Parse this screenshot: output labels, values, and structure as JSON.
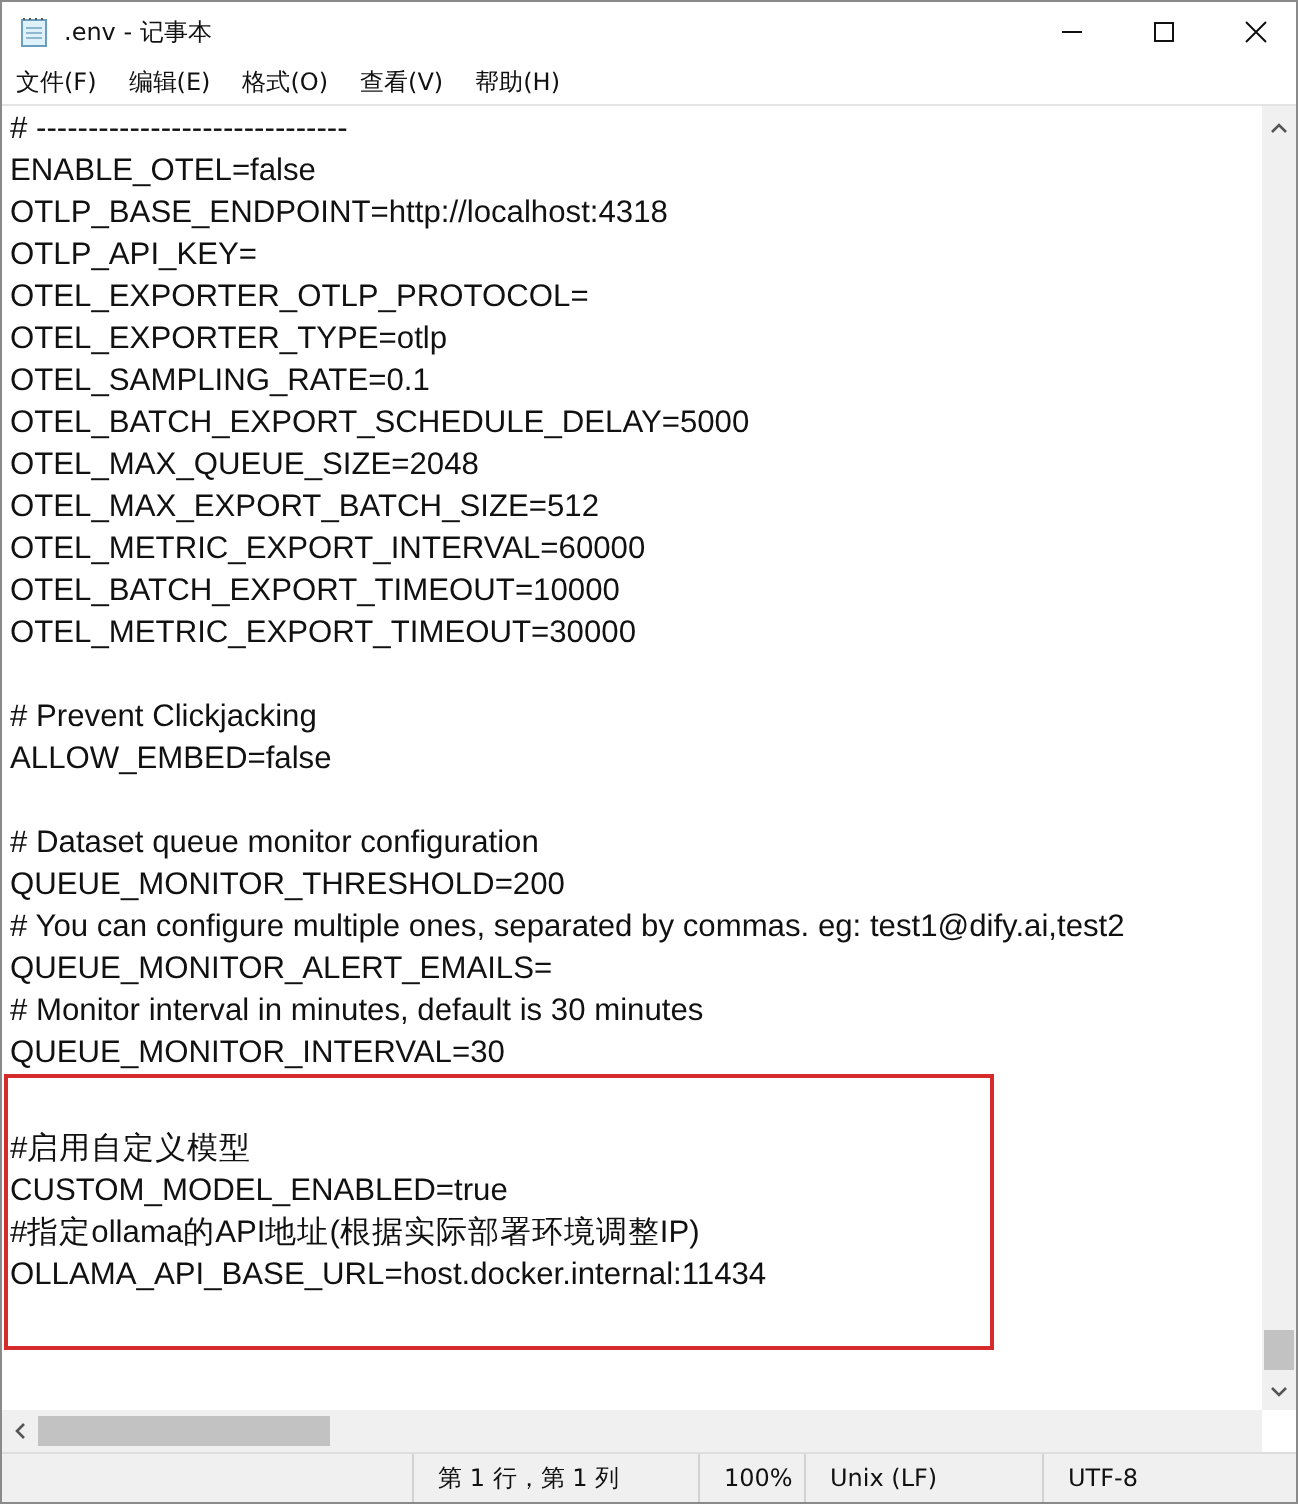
{
  "window": {
    "title": ".env - 记事本"
  },
  "menu": [
    "文件(F)",
    "编辑(E)",
    "格式(O)",
    "查看(V)",
    "帮助(H)"
  ],
  "editor": {
    "lines": [
      {
        "kind": "text",
        "text": "# ------------------------------"
      },
      {
        "kind": "text",
        "text": "ENABLE_OTEL=false"
      },
      {
        "kind": "text",
        "text": "OTLP_BASE_ENDPOINT=http://localhost:4318"
      },
      {
        "kind": "text",
        "text": "OTLP_API_KEY="
      },
      {
        "kind": "text",
        "text": "OTEL_EXPORTER_OTLP_PROTOCOL="
      },
      {
        "kind": "text",
        "text": "OTEL_EXPORTER_TYPE=otlp"
      },
      {
        "kind": "text",
        "text": "OTEL_SAMPLING_RATE=0.1"
      },
      {
        "kind": "text",
        "text": "OTEL_BATCH_EXPORT_SCHEDULE_DELAY=5000"
      },
      {
        "kind": "text",
        "text": "OTEL_MAX_QUEUE_SIZE=2048"
      },
      {
        "kind": "text",
        "text": "OTEL_MAX_EXPORT_BATCH_SIZE=512"
      },
      {
        "kind": "text",
        "text": "OTEL_METRIC_EXPORT_INTERVAL=60000"
      },
      {
        "kind": "text",
        "text": "OTEL_BATCH_EXPORT_TIMEOUT=10000"
      },
      {
        "kind": "text",
        "text": "OTEL_METRIC_EXPORT_TIMEOUT=30000"
      },
      {
        "kind": "blank"
      },
      {
        "kind": "text",
        "text": "# Prevent Clickjacking"
      },
      {
        "kind": "text",
        "text": "ALLOW_EMBED=false"
      },
      {
        "kind": "blank"
      },
      {
        "kind": "text",
        "text": "# Dataset queue monitor configuration"
      },
      {
        "kind": "text",
        "text": "QUEUE_MONITOR_THRESHOLD=200"
      },
      {
        "kind": "text",
        "text": "# You can configure multiple ones, separated by commas. eg: test1@dify.ai,test2"
      },
      {
        "kind": "text",
        "text": "QUEUE_MONITOR_ALERT_EMAILS="
      },
      {
        "kind": "text",
        "text": "# Monitor interval in minutes, default is 30 minutes"
      },
      {
        "kind": "text",
        "text": "QUEUE_MONITOR_INTERVAL=30"
      }
    ],
    "highlighted_block": {
      "lines": [
        {
          "kind": "blank"
        },
        {
          "kind": "text",
          "text": "#启用自定义模型"
        },
        {
          "kind": "text",
          "text": "CUSTOM_MODEL_ENABLED=true"
        },
        {
          "kind": "text",
          "text": "#指定ollama的API地址(根据实际部署环境调整IP)"
        },
        {
          "kind": "text",
          "text": "OLLAMA_API_BASE_URL=host.docker.internal:11434"
        },
        {
          "kind": "blank"
        },
        {
          "kind": "blank"
        }
      ]
    }
  },
  "status_bar": [
    "第 1 行，第 1 列",
    "100%",
    "Unix (LF)",
    "UTF-8"
  ]
}
